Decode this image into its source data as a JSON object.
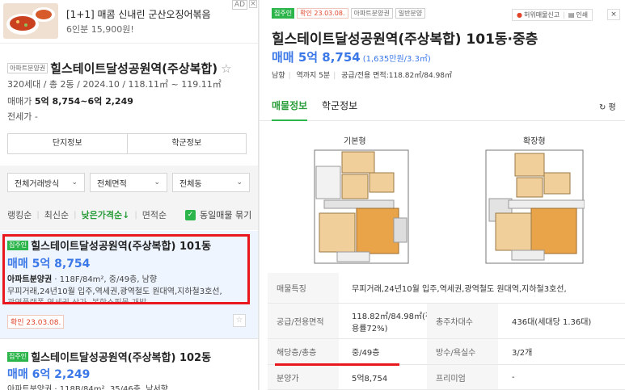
{
  "ad": {
    "title": "[1+1] 매콤 신내린 군산오징어볶음",
    "sub": "6인분 15,900원!",
    "badge": "AD",
    "close": "×"
  },
  "complex": {
    "tag": "아파트분양권",
    "name": "힐스테이트달성공원역(주상복합)",
    "meta": "320세대 / 총 2동 / 2024.10 / 118.11㎡ ~ 119.11㎡",
    "price_label": "매매가",
    "price_value": "5억 8,754~6억 2,249",
    "jeonse": "전세가 -",
    "tab_info": "단지정보",
    "tab_price": "학군정보"
  },
  "filters": {
    "trade": "전체거래방식",
    "area": "전체면적",
    "dong": "전체동"
  },
  "sort": {
    "items": [
      "랭킹순",
      "최신순",
      "낮은가격순↓",
      "면적순"
    ],
    "same_listing": "동일매물 묶기"
  },
  "listing1": {
    "badge": "집주인",
    "name": "힐스테이트달성공원역(주상복합) 101동",
    "price": "매매 5억 8,754",
    "type": "아파트분양권",
    "detail": "118F/84m², 중/49층, 남향",
    "desc": "무피거래,24년10월 입주,역세권,광역철도 원대역,지하철3호선,",
    "desc2": "광역플랫폼 역세권 상가, 복합쇼핑몰 개발",
    "confirm": "확인 23.03.08."
  },
  "listing2": {
    "badge": "집주인",
    "name": "힐스테이트달성공원역(주상복합) 102동",
    "price": "매매 6억 2,249",
    "detail": "아파트분양권 · 118B/84m², 35/46층, 남서향"
  },
  "detail": {
    "tag_owner": "집주인",
    "tag_confirm": "확인 23.03.08.",
    "tag_type": "아파트분양권",
    "tag_sale": "일반분양",
    "report": "허위매물신고",
    "print": "인쇄",
    "close": "×",
    "title": "힐스테이트달성공원역(주상복합) 101동·중층",
    "price": "매매 5억 8,754",
    "per_py": "(1,635만원/3.3㎡)",
    "info": [
      "남향",
      "역까지 5분",
      "공급/전용 면적:118.82㎡/84.98㎡"
    ],
    "tab_listing": "매물정보",
    "tab_school": "학군정보",
    "refresh": "↻ 평",
    "plan_basic": "기본형",
    "plan_ext": "확장형",
    "rows": [
      {
        "th": "매물특징",
        "td": "무피거래,24년10월 입주,역세권,광역철도 원대역,지하철3호선,"
      },
      {
        "th": "공급/전용면적",
        "td1": "118.82㎡/84.98㎡(전",
        "td1b": "용률72%)",
        "th2": "총주차대수",
        "td2": "436대(세대당 1.36대)"
      },
      {
        "th": "해당층/총층",
        "td1": "중/49층",
        "th2": "방수/욕실수",
        "td2": "3/2개"
      },
      {
        "th": "분양가",
        "td1": "5억8,754",
        "th2": "프리미엄",
        "td2": "-"
      }
    ]
  }
}
